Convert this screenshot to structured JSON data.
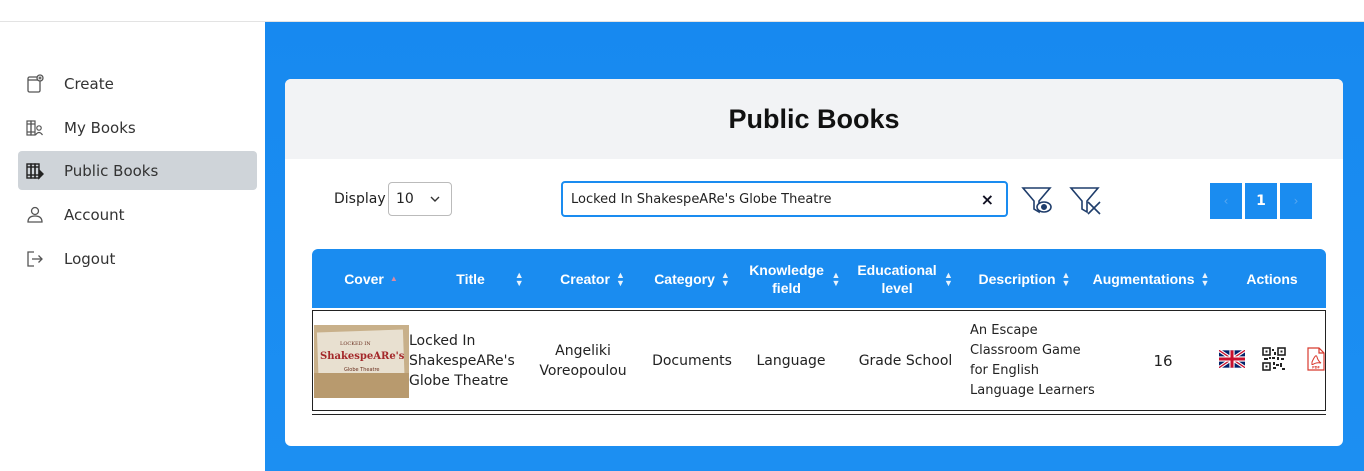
{
  "sidebar": {
    "items": [
      {
        "label": "Create",
        "icon": "create-book-icon"
      },
      {
        "label": "My Books",
        "icon": "my-books-icon"
      },
      {
        "label": "Public Books",
        "icon": "public-books-icon",
        "active": true
      },
      {
        "label": "Account",
        "icon": "user-icon"
      },
      {
        "label": "Logout",
        "icon": "logout-icon"
      }
    ]
  },
  "page": {
    "title": "Public Books"
  },
  "controls": {
    "display_label": "Display",
    "display_value": "10",
    "search_value": "Locked In ShakespeARe's Globe Theatre",
    "clear_symbol": "×",
    "pages": [
      "‹",
      "1",
      "›"
    ]
  },
  "table": {
    "columns": [
      "Cover",
      "Title",
      "Creator",
      "Category",
      "Knowledge field",
      "Educational level",
      "Description",
      "Augmentations",
      "Actions"
    ],
    "rows": [
      {
        "cover_text": {
          "top": "LOCKED IN",
          "main": "ShakespeARe's",
          "sub": "Globe Theatre"
        },
        "title": "Locked In ShakespeARe's Globe Theatre",
        "creator": "Angeliki Voreopoulou",
        "category": "Documents",
        "knowledge_field": "Language",
        "educational_level": "Grade School",
        "description": "An Escape Classroom Game for English Language Learners",
        "augmentations": "16",
        "actions": [
          "uk-flag-icon",
          "qr-code-icon",
          "pdf-icon"
        ]
      }
    ]
  },
  "colors": {
    "primary": "#1a8cf0",
    "active_nav": "#cfd4d9",
    "header_bg": "#f2f3f5"
  }
}
